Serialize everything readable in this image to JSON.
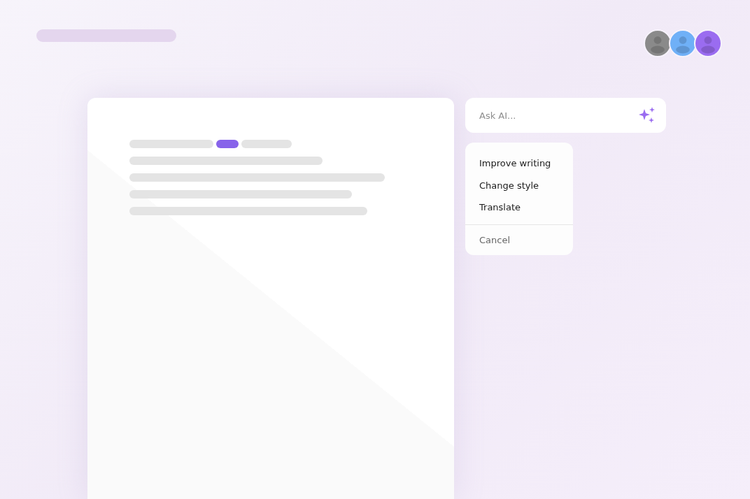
{
  "avatars": [
    {
      "color": "#8a8a8a"
    },
    {
      "color": "#6fb0f7"
    },
    {
      "color": "#9a6cf0"
    }
  ],
  "document": {
    "lines": [
      {
        "segments": [
          {
            "highlighted": false
          },
          {
            "highlighted": true
          },
          {
            "highlighted": false
          }
        ]
      },
      {
        "segments": [
          {
            "highlighted": false
          }
        ]
      },
      {
        "segments": [
          {
            "highlighted": false
          }
        ]
      },
      {
        "segments": [
          {
            "highlighted": false
          }
        ]
      },
      {
        "segments": [
          {
            "highlighted": false
          }
        ]
      }
    ]
  },
  "ask_field": {
    "placeholder": "Ask AI..."
  },
  "menu": [
    {
      "label": "Improve writing",
      "kind": "action"
    },
    {
      "label": "Change style",
      "kind": "action"
    },
    {
      "label": "Translate",
      "kind": "action"
    },
    {
      "label": "Cancel",
      "kind": "cancel"
    }
  ]
}
